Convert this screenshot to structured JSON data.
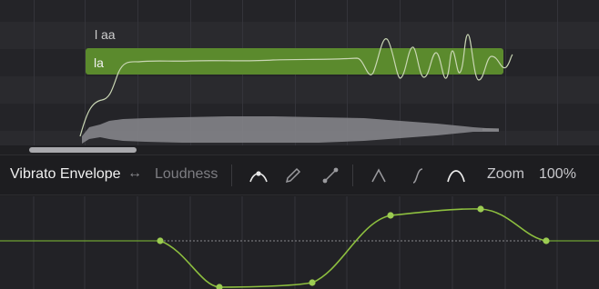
{
  "notes": [
    {
      "lyric": "l aa"
    },
    {
      "lyric": "la"
    }
  ],
  "toolbar": {
    "primary_param": "Vibrato Envelope",
    "swap_icon": "↔",
    "secondary_param": "Loudness",
    "tools": [
      {
        "name": "point-select-tool-icon"
      },
      {
        "name": "pencil-tool-icon"
      },
      {
        "name": "line-tool-icon"
      },
      {
        "name": "sharp-peak-shape-icon"
      },
      {
        "name": "s-curve-shape-icon"
      },
      {
        "name": "smooth-peak-shape-icon"
      }
    ],
    "zoom_label": "Zoom",
    "zoom_value": "100%"
  },
  "colors": {
    "note_fill": "#5b8a2d",
    "envelope_curve": "#8dbf3f",
    "control_point": "#9ccc52",
    "waveform": "#8a8a8e"
  }
}
